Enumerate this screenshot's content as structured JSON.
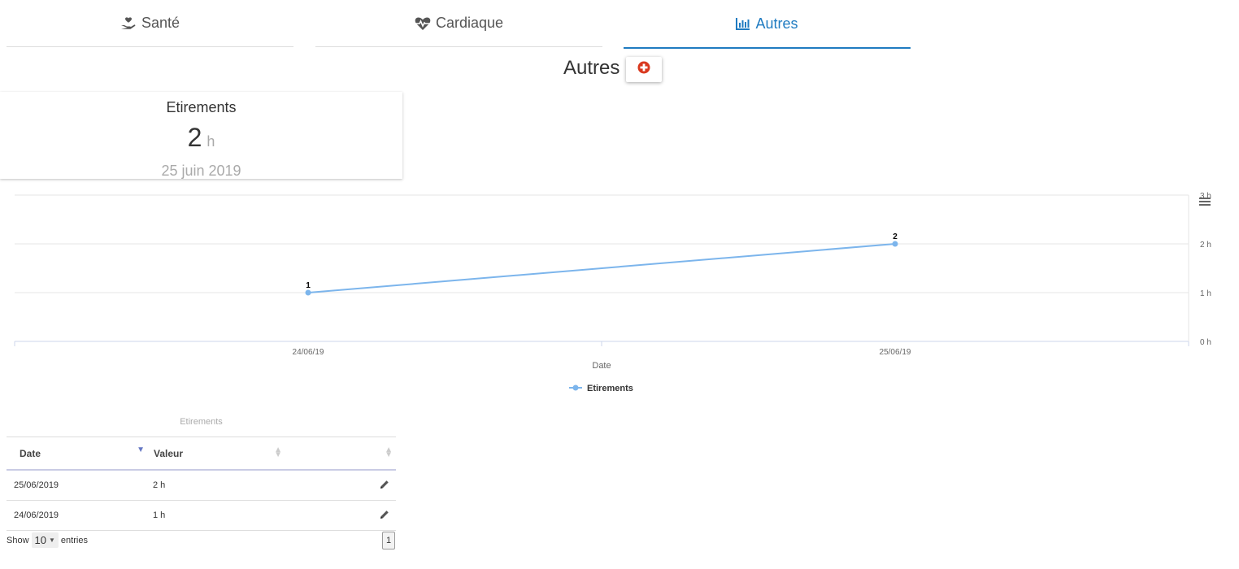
{
  "tabs": [
    {
      "label": "Santé",
      "icon": "hand-heart-icon",
      "active": false
    },
    {
      "label": "Cardiaque",
      "icon": "heartbeat-icon",
      "active": false
    },
    {
      "label": "Autres",
      "icon": "bar-chart-icon",
      "active": true
    }
  ],
  "section": {
    "title": "Autres"
  },
  "card": {
    "title": "Etirements",
    "value": "2",
    "unit": "h",
    "date": "25 juin 2019"
  },
  "colors": {
    "accent": "#1f7bc1",
    "series": "#7cb5ec",
    "add_button": "#d9381e"
  },
  "chart_data": {
    "type": "line",
    "x": [
      "24/06/19",
      "25/06/19"
    ],
    "series": [
      {
        "name": "Etirements",
        "values": [
          1,
          2
        ]
      }
    ],
    "xlabel": "Date",
    "y_ticks": [
      "0 h",
      "1 h",
      "2 h",
      "3 h"
    ],
    "ylim": [
      0,
      3
    ],
    "grid": true,
    "legend": "bottom-center",
    "data_labels": [
      "1",
      "2"
    ]
  },
  "table": {
    "caption": "Etirements",
    "headers": [
      "Date",
      "Valeur",
      ""
    ],
    "rows": [
      {
        "date": "25/06/2019",
        "value": "2 h"
      },
      {
        "date": "24/06/2019",
        "value": "1 h"
      }
    ],
    "show_label": "Show",
    "page_size": "10",
    "entries_label": "entries",
    "page": "1"
  }
}
